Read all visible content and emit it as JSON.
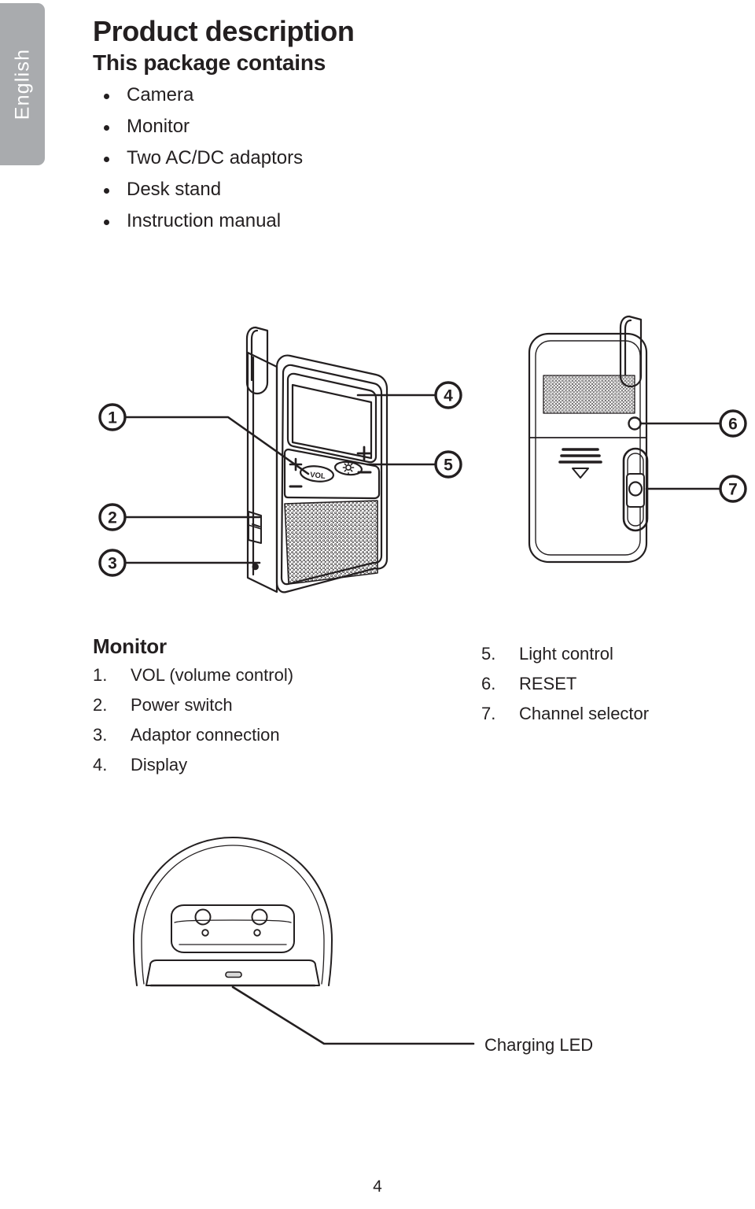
{
  "sidebar": {
    "language_label": "English",
    "tab_color": "#a9abae",
    "text_color": "#ffffff"
  },
  "header": {
    "title": "Product description",
    "subtitle": "This package contains"
  },
  "package_contents": [
    {
      "label": "Camera"
    },
    {
      "label": "Monitor"
    },
    {
      "label": "Two AC/DC adaptors"
    },
    {
      "label": "Desk stand"
    },
    {
      "label": "Instruction manual"
    }
  ],
  "diagram": {
    "monitor_front": {
      "callouts": [
        {
          "number": "1",
          "target": "vol-button"
        },
        {
          "number": "2",
          "target": "power-switch"
        },
        {
          "number": "3",
          "target": "adaptor-connection"
        },
        {
          "number": "4",
          "target": "display"
        },
        {
          "number": "5",
          "target": "light-control"
        }
      ],
      "vol_label": "VOL",
      "plus_label": "+",
      "minus_label": "–",
      "light_icon": "brightness-icon"
    },
    "monitor_back": {
      "callouts": [
        {
          "number": "6",
          "target": "reset-hole"
        },
        {
          "number": "7",
          "target": "channel-selector"
        }
      ]
    }
  },
  "parts": {
    "monitor_heading": "Monitor",
    "left_items": [
      {
        "num": "1.",
        "label": "VOL (volume control)"
      },
      {
        "num": "2.",
        "label": "Power switch"
      },
      {
        "num": "3.",
        "label": "Adaptor connection"
      },
      {
        "num": "4.",
        "label": "Display"
      }
    ],
    "right_items": [
      {
        "num": "5.",
        "label": "Light control"
      },
      {
        "num": "6.",
        "label": "RESET"
      },
      {
        "num": "7.",
        "label": "Channel selector"
      }
    ]
  },
  "stand": {
    "callout_label": "Charging LED"
  },
  "footer": {
    "page_number": "4"
  },
  "colors": {
    "ink": "#231f20",
    "line": "#231f20",
    "gray_tab": "#a9abae",
    "page_bg": "#ffffff"
  }
}
